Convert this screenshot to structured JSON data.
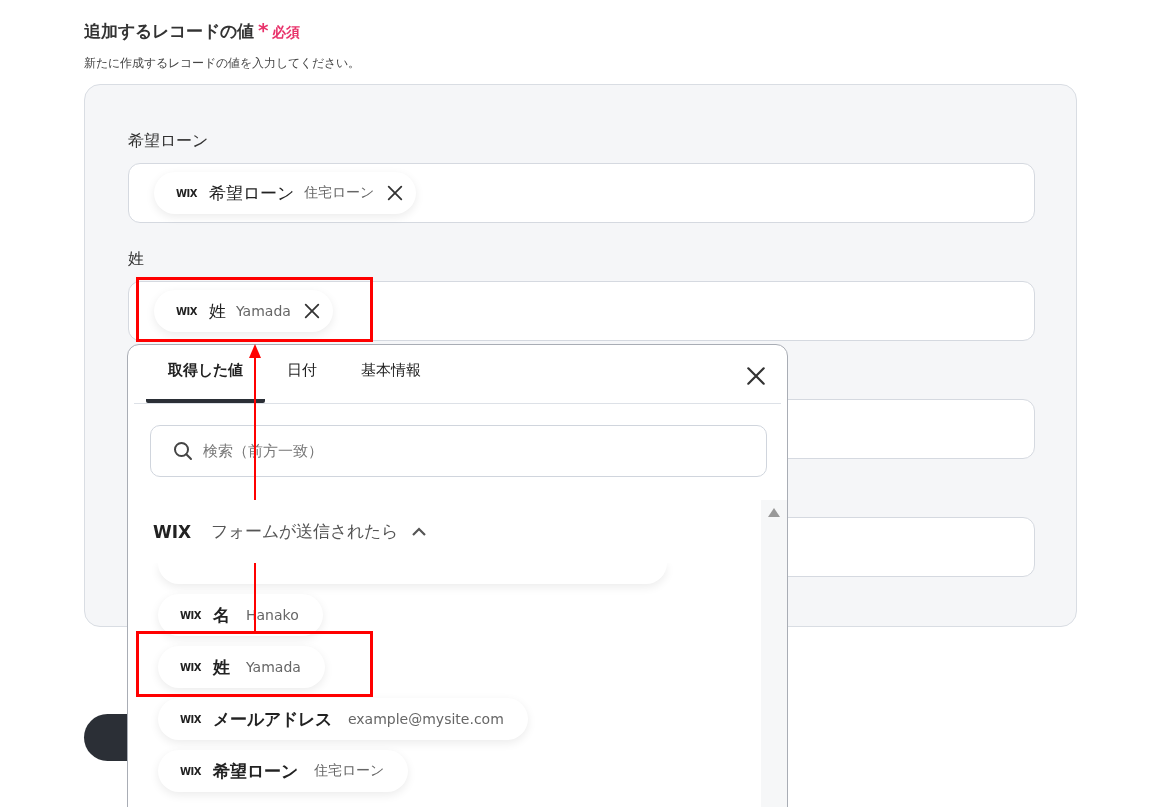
{
  "section": {
    "title": "追加するレコードの値",
    "required_mark": "*",
    "required_label": "必須",
    "description": "新たに作成するレコードの値を入力してください。"
  },
  "fields": [
    {
      "kind": "chip",
      "label": "希望ローン",
      "chip": {
        "service": "WIX",
        "name": "希望ローン",
        "value": "住宅ローン"
      }
    },
    {
      "kind": "chip",
      "label": "姓",
      "chip": {
        "service": "WIX",
        "name": "姓",
        "value": "Yamada"
      }
    },
    {
      "kind": "empty"
    },
    {
      "kind": "empty"
    }
  ],
  "picker": {
    "tabs": [
      {
        "label": "取得した値",
        "selected": true
      },
      {
        "label": "日付",
        "selected": false
      },
      {
        "label": "基本情報",
        "selected": false
      }
    ],
    "search": {
      "placeholder": "検索（前方一致）"
    },
    "group": {
      "service": "WIX",
      "title": "フォームが送信されたら",
      "expanded": true
    },
    "items": [
      {
        "kind": "partial"
      },
      {
        "kind": "value",
        "service": "WIX",
        "name": "名",
        "value": "Hanako"
      },
      {
        "kind": "value",
        "service": "WIX",
        "name": "姓",
        "value": "Yamada"
      },
      {
        "kind": "value",
        "service": "WIX",
        "name": "メールアドレス",
        "value": "example@mysite.com"
      },
      {
        "kind": "value",
        "service": "WIX",
        "name": "希望ローン",
        "value": "住宅ローン"
      }
    ]
  }
}
